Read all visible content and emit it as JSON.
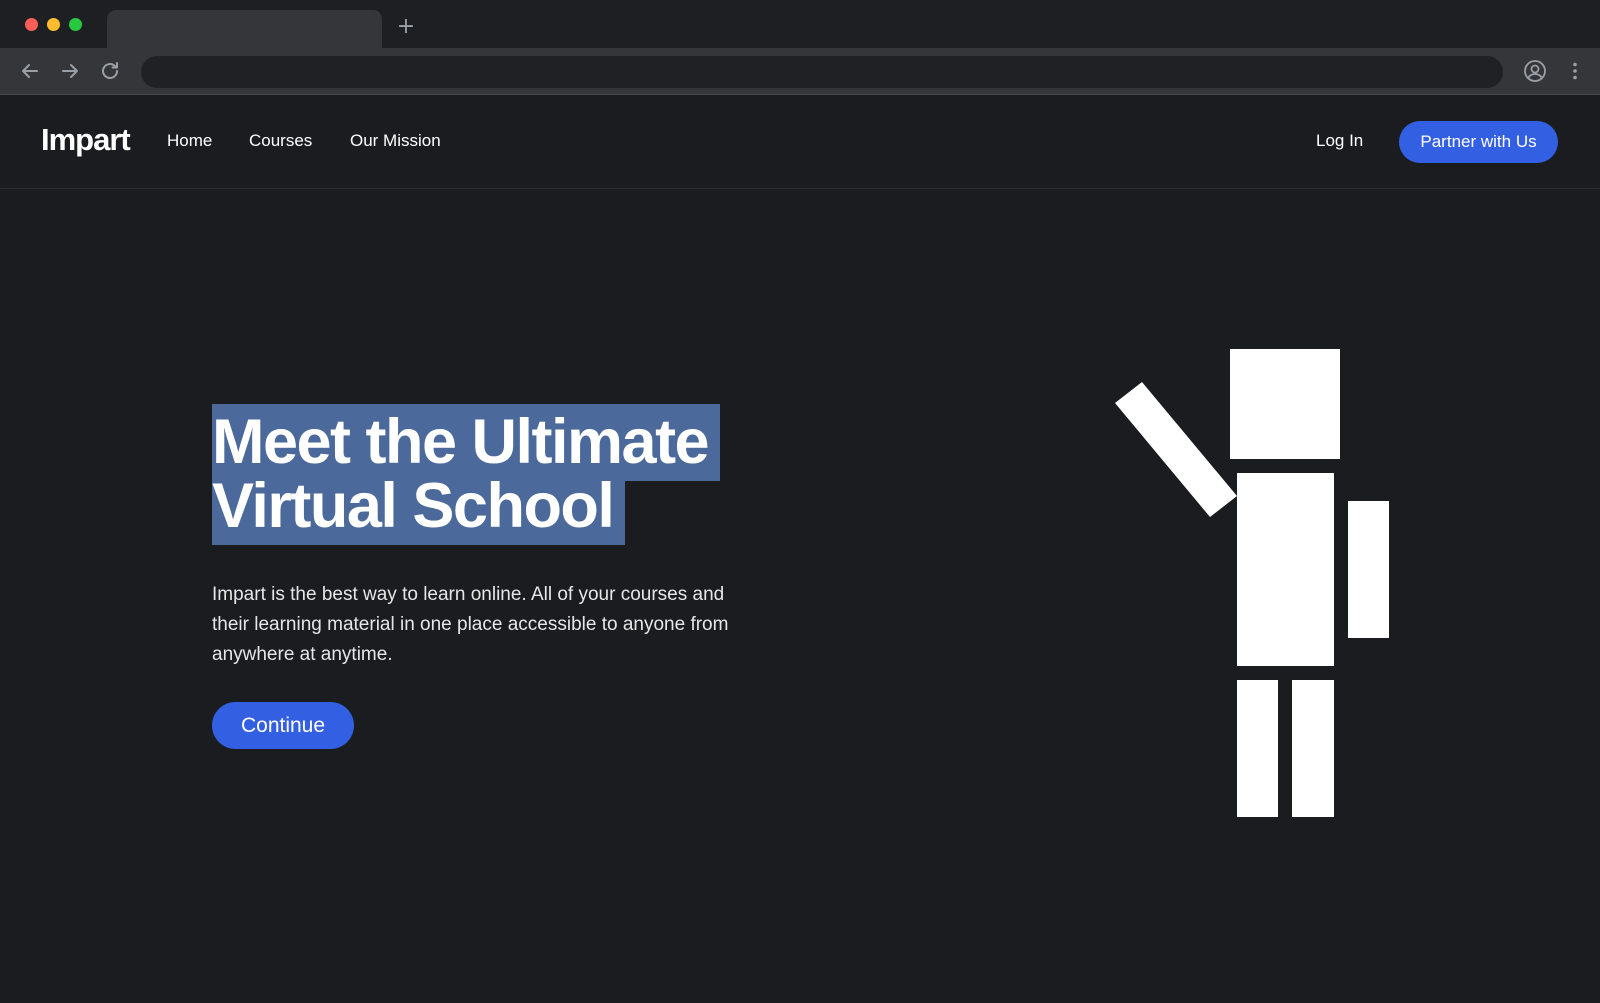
{
  "browser": {
    "new_tab_symbol": "+",
    "traffic_lights": [
      "#ff5f57",
      "#febc2e",
      "#28c840"
    ]
  },
  "site": {
    "logo": "Impart",
    "nav": [
      "Home",
      "Courses",
      "Our Mission"
    ],
    "login": "Log In",
    "cta": "Partner with Us"
  },
  "hero": {
    "title_line1": "Meet the Ultimate",
    "title_line2": "Virtual School",
    "description": "Impart is the best way to learn online. All of your courses and their learning material in one place accessible to anyone from anywhere at anytime.",
    "button": "Continue"
  },
  "colors": {
    "background": "#1b1c20",
    "accent": "#3360e3",
    "selection": "#4b6a9b"
  }
}
